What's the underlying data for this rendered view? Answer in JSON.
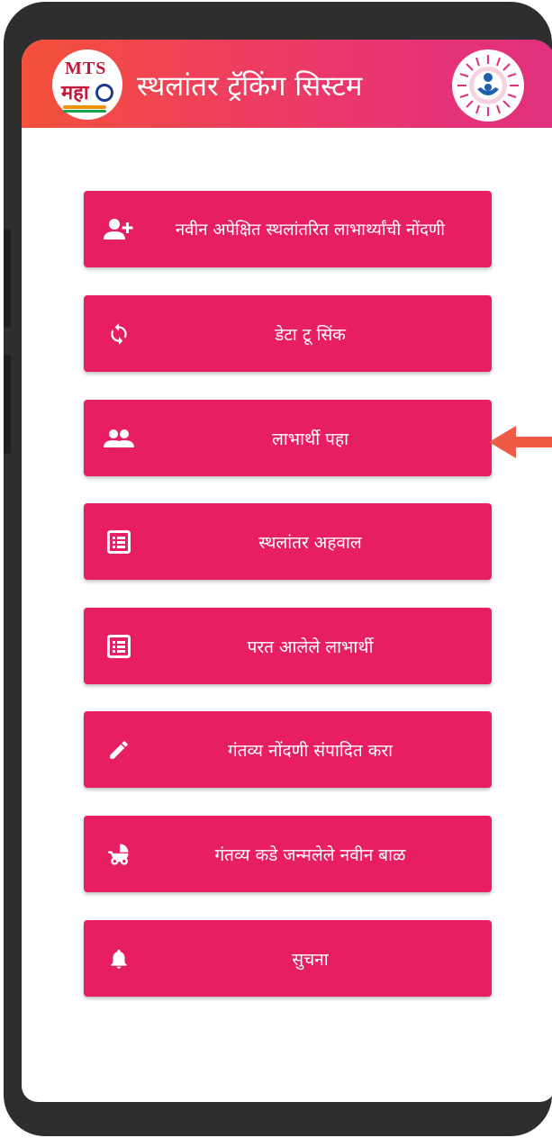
{
  "app": {
    "title": "स्थलांतर ट्रॅकिंग सिस्टम",
    "logo_text_top": "MTS",
    "logo_text_bottom": "महा"
  },
  "menu": [
    {
      "label": "नवीन अपेक्षित स्थलांतरित लाभार्थ्यांची नोंदणी",
      "icon": "add-person-icon"
    },
    {
      "label": "डेटा टू सिंक",
      "icon": "sync-icon"
    },
    {
      "label": "लाभार्थी पहा",
      "icon": "people-icon"
    },
    {
      "label": "स्थलांतर अहवाल",
      "icon": "list-report-icon"
    },
    {
      "label": "परत आलेले लाभार्थी",
      "icon": "list-report-icon"
    },
    {
      "label": "गंतव्य नोंदणी संपादित करा",
      "icon": "pencil-icon"
    },
    {
      "label": "गंतव्य कडे जन्मलेले नवीन बाळ",
      "icon": "baby-stroller-icon"
    },
    {
      "label": "सुचना",
      "icon": "bell-icon"
    }
  ],
  "colors": {
    "button": "#e81e63",
    "header_start": "#f4503a",
    "header_end": "#e0317d",
    "annotation_arrow": "#ee5a45"
  }
}
